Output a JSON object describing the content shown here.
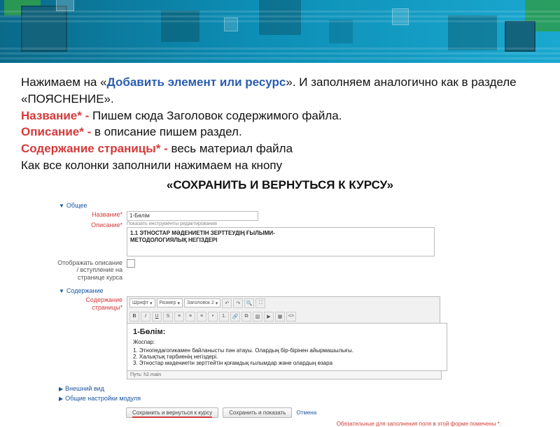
{
  "instructions": {
    "p1_a": "Нажимаем на «",
    "p1_link": "Добавить элемент или ресурс",
    "p1_b": "».  И заполняем аналогично как в разделе  «ПОЯСНЕНИЕ».",
    "name_lbl": "Название* - ",
    "name_txt": "Пишем сюда Заголовок содержимого файла.",
    "desc_lbl": "Описание* - ",
    "desc_txt": "в описание пишем раздел.",
    "cont_lbl": "Содержание страницы* - ",
    "cont_txt": "весь материал файла",
    "final": "Как все колонки заполнили нажимаем на кнопу",
    "save": "«СОХРАНИТЬ И ВЕРНУТЬСЯ К КУРСУ»"
  },
  "form": {
    "sec_general": "Общее",
    "lbl_name": "Название*",
    "val_name": "1-Бөлім",
    "lbl_desc": "Описание*",
    "desc_toolbar_hint": "Показать инструменты редактирования",
    "desc_value_1": "1.1 ЭТНОСТАР МӘДЕНИЕТІН ЗЕРТТЕУДІҢ ҒЫЛЫМИ-",
    "desc_value_2": "МЕТОДОЛОГИЯЛЫҚ НЕГІЗДЕРІ",
    "lbl_show": "Отображать описание / вступление на странице курса",
    "sec_content": "Содержание",
    "lbl_page": "Содержание страницы*",
    "tb_font": "Шрифт",
    "tb_size": "Размер",
    "tb_head": "Заголовок 2",
    "ed_title": "1-Бөлім:",
    "ed_plan": "Жоспар:",
    "ed_l1": "1. Этнопедагогикамен байланысты пән атауы. Олардың бір-бірінен айырмашылығы.",
    "ed_l2": "2. Халықтық тәрбиенің негіздері.",
    "ed_l3": "3. Этностар мәдениетін зерттейтін қоғамдық ғылымдар және олардың өзара",
    "path": "Путь: h2.main",
    "sec_appearance": "Внешний вид",
    "sec_module": "Общие настройки модуля",
    "btn_save_return": "Сохранить и вернуться к курсу",
    "btn_save_show": "Сохранить и показать",
    "btn_cancel": "Отмена",
    "req_note": "Обязательные для заполнения поля в этой форме помечены *."
  }
}
